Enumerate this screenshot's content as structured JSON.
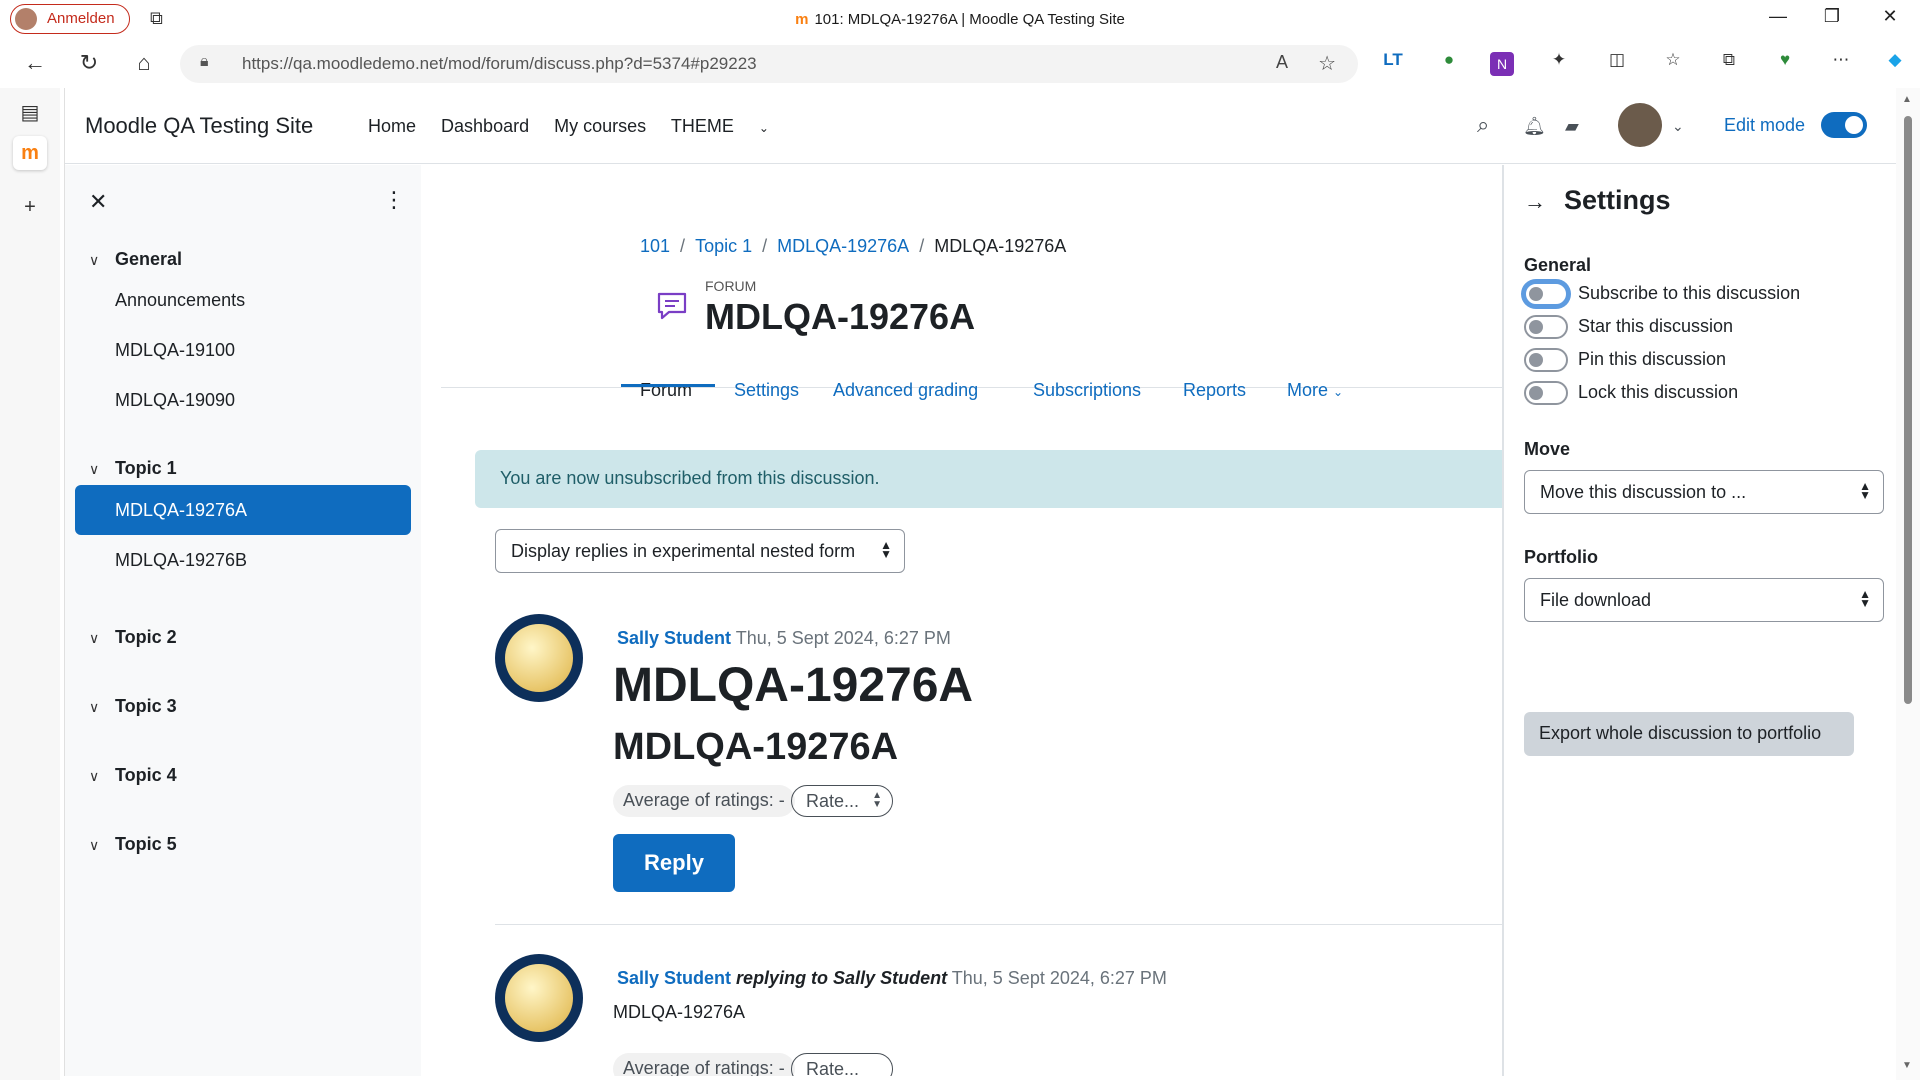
{
  "browser": {
    "profile_label": "Anmelden",
    "window_title": "101: MDLQA-19276A | Moodle QA Testing Site",
    "tab_favicon": "m",
    "url": "https://qa.moodledemo.net/mod/forum/discuss.php?d=5374#p29223",
    "icons": [
      "back-icon",
      "refresh-icon",
      "home-icon",
      "lock-icon",
      "read-aloud-icon",
      "favorite-icon",
      "extension-icon",
      "split-screen-icon",
      "favorites-icon",
      "collections-icon",
      "browser-essentials-icon",
      "more-icon",
      "copilot-icon"
    ]
  },
  "navbar": {
    "brand": "Moodle QA Testing Site",
    "links": [
      "Home",
      "Dashboard",
      "My courses",
      "THEME"
    ],
    "edit_mode_label": "Edit mode",
    "edit_mode_on": true
  },
  "course_index": {
    "sections": [
      {
        "title": "General",
        "items": [
          "Announcements",
          "MDLQA-19100",
          "MDLQA-19090"
        ]
      },
      {
        "title": "Topic 1",
        "items": [
          "MDLQA-19276A",
          "MDLQA-19276B"
        ]
      },
      {
        "title": "Topic 2",
        "items": []
      },
      {
        "title": "Topic 3",
        "items": []
      },
      {
        "title": "Topic 4",
        "items": []
      },
      {
        "title": "Topic 5",
        "items": []
      }
    ],
    "active_item": "MDLQA-19276A"
  },
  "breadcrumb": [
    "101",
    "Topic 1",
    "MDLQA-19276A",
    "MDLQA-19276A"
  ],
  "activity": {
    "type_label": "FORUM",
    "title": "MDLQA-19276A"
  },
  "tabs": [
    "Forum",
    "Settings",
    "Advanced grading",
    "Subscriptions",
    "Reports",
    "More"
  ],
  "active_tab": "Forum",
  "alert": "You are now unsubscribed from this discussion.",
  "display_mode": "Display replies in experimental nested form",
  "posts": [
    {
      "author": "Sally Student",
      "reply_to": "",
      "date": "Thu, 5 Sept 2024, 6:27 PM",
      "subject": "MDLQA-19276A",
      "body_heading": "MDLQA-19276A",
      "rating_avg": "Average of ratings: -",
      "rate_select": "Rate...",
      "reply_label": "Reply"
    },
    {
      "author": "Sally Student",
      "reply_to": "replying to Sally Student",
      "date": "Thu, 5 Sept 2024, 6:27 PM",
      "body": "MDLQA-19276A",
      "rating_avg": "Average of ratings: -",
      "rate_select": "Rate..."
    }
  ],
  "settings_drawer": {
    "title": "Settings",
    "general_heading": "General",
    "toggles": [
      {
        "label": "Subscribe to this discussion",
        "on": false
      },
      {
        "label": "Star this discussion",
        "on": false
      },
      {
        "label": "Pin this discussion",
        "on": false
      },
      {
        "label": "Lock this discussion",
        "on": false
      }
    ],
    "move_heading": "Move",
    "move_select": "Move this discussion to ...",
    "portfolio_heading": "Portfolio",
    "portfolio_select": "File download",
    "export_button": "Export whole discussion to portfolio"
  },
  "colors": {
    "primary": "#0f6cbf",
    "alert_bg": "#cde6ea",
    "moodle_orange": "#f98012"
  }
}
